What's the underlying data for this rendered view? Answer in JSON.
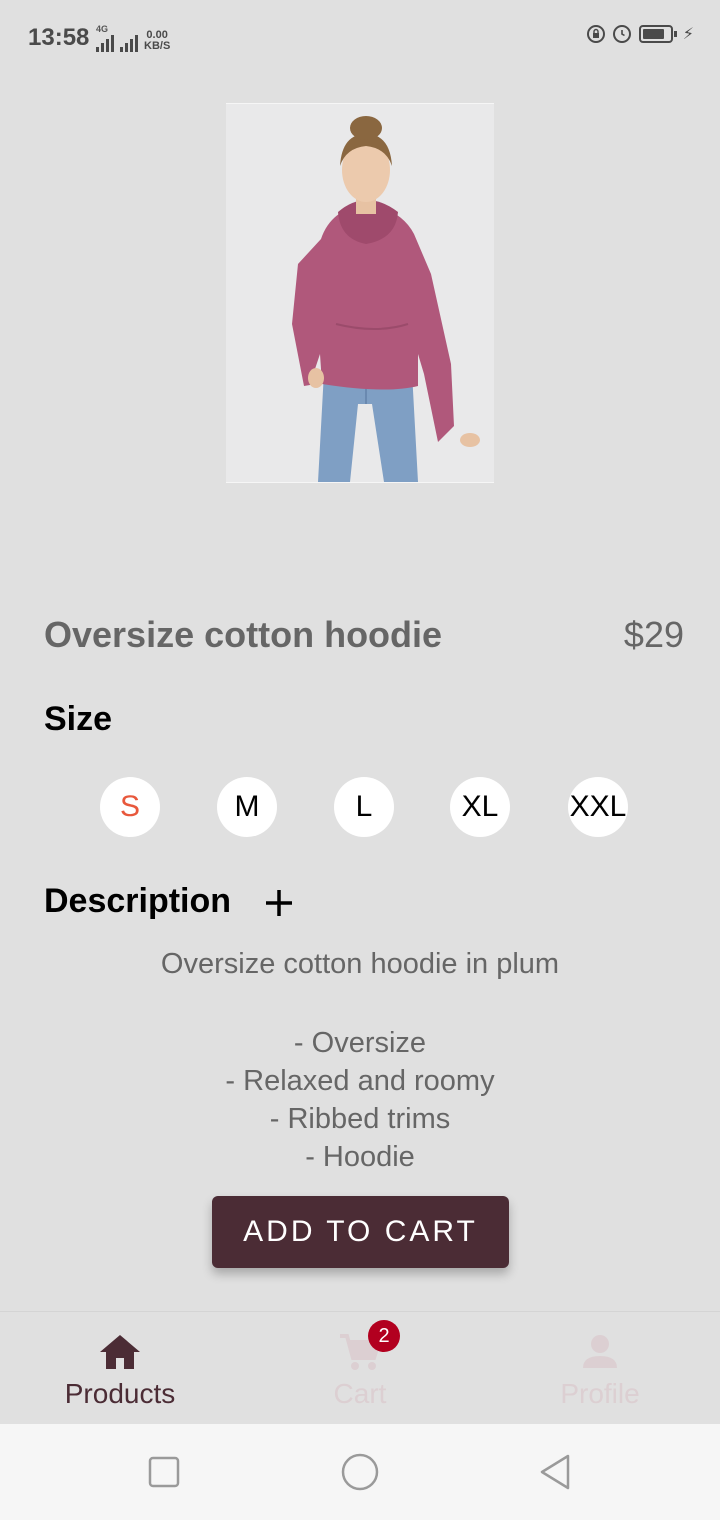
{
  "status_bar": {
    "time": "13:58",
    "network_type": "4G",
    "speed_value": "0.00",
    "speed_unit": "KB/S"
  },
  "product": {
    "image_alt": "Model wearing plum oversize cotton hoodie",
    "title": "Oversize cotton hoodie",
    "price": "$29"
  },
  "size_section": {
    "heading": "Size",
    "options": [
      "S",
      "M",
      "L",
      "XL",
      "XXL"
    ],
    "selected": "S"
  },
  "description": {
    "heading": "Description",
    "toggle_icon": "plus-icon",
    "intro": "Oversize cotton hoodie in plum",
    "bullets": [
      "- Oversize",
      "- Relaxed and roomy",
      "- Ribbed trims",
      "- Hoodie"
    ]
  },
  "cart_button": {
    "label": "ADD TO CART"
  },
  "bottom_nav": {
    "items": [
      {
        "label": "Products",
        "icon": "home-icon",
        "active": true
      },
      {
        "label": "Cart",
        "icon": "cart-icon",
        "active": false,
        "badge": "2"
      },
      {
        "label": "Profile",
        "icon": "person-icon",
        "active": false
      }
    ]
  },
  "system_nav": {
    "buttons": [
      "recent-apps",
      "home",
      "back"
    ]
  },
  "colors": {
    "accent": "#4b2c35",
    "selected_size": "#e8583c",
    "badge": "#b2001f",
    "background": "#e0e0e0"
  }
}
